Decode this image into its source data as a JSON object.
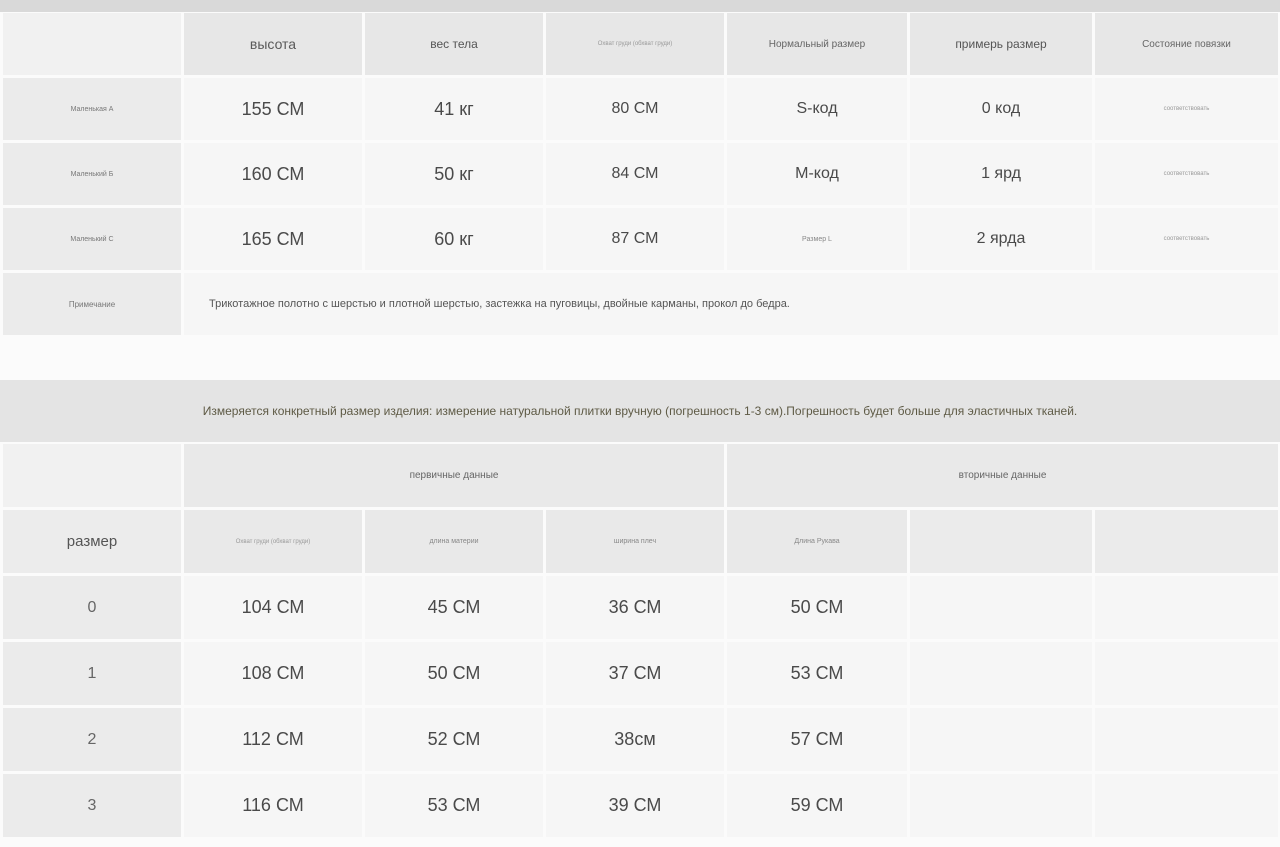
{
  "size_chart": {
    "headers": [
      "",
      "высота",
      "вес тела",
      "Охват груди (обхват груди)",
      "Нормальный размер",
      "примерь размер",
      "Состояние повязки"
    ],
    "rows": [
      {
        "label": "Маленькая А",
        "height": "155 СМ",
        "weight": "41 кг",
        "chest": "80 СМ",
        "normal": "S-код",
        "try": "0 код",
        "status": "соответствовать"
      },
      {
        "label": "Маленький Б",
        "height": "160 СМ",
        "weight": "50 кг",
        "chest": "84 СМ",
        "normal": "М-код",
        "try": "1 ярд",
        "status": "соответствовать"
      },
      {
        "label": "Маленький С",
        "height": "165 СМ",
        "weight": "60 кг",
        "chest": "87 СМ",
        "normal": "Размер L",
        "try": "2 ярда",
        "status": "соответствовать"
      }
    ],
    "note_label": "Примечание",
    "note_text": "Трикотажное полотно с шерстью и плотной шерстью, застежка на пуговицы, двойные карманы, прокол до бедра."
  },
  "banner": "Измеряется конкретный размер изделия: измерение натуральной плитки вручную (погрешность 1-3 см).Погрешность будет больше для эластичных тканей.",
  "measure_table": {
    "group_primary": "первичные данные",
    "group_secondary": "вторичные данные",
    "size_label": "размер",
    "col_headers": [
      "Охват груди (обхват груди)",
      "длина материи",
      "ширина плеч",
      "Длина Рукава",
      "",
      ""
    ],
    "rows": [
      {
        "size": "0",
        "c1": "104 СМ",
        "c2": "45 СМ",
        "c3": "36 СМ",
        "c4": "50 СМ"
      },
      {
        "size": "1",
        "c1": "108 СМ",
        "c2": "50 СМ",
        "c3": "37 СМ",
        "c4": "53 СМ"
      },
      {
        "size": "2",
        "c1": "112 СМ",
        "c2": "52 СМ",
        "c3": "38см",
        "c4": "57 СМ"
      },
      {
        "size": "3",
        "c1": "116 СМ",
        "c2": "53 СМ",
        "c3": "39 СМ",
        "c4": "59 СМ"
      }
    ]
  }
}
